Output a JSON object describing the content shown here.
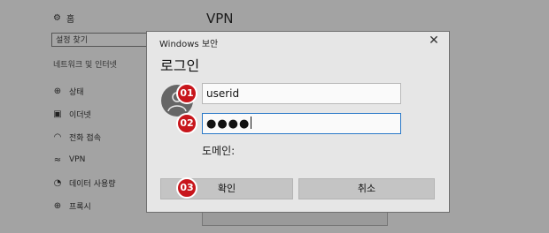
{
  "background": {
    "home": {
      "label": "홈",
      "icon": "gear-icon"
    },
    "search_placeholder": "설정 찾기",
    "section_label": "네트워크 및 인터넷",
    "nav": [
      {
        "label": "상태",
        "icon": "globe-icon"
      },
      {
        "label": "이더넷",
        "icon": "ethernet-icon"
      },
      {
        "label": "전화 접속",
        "icon": "wifi-icon"
      },
      {
        "label": "VPN",
        "icon": "vpn-icon"
      },
      {
        "label": "데이터 사용량",
        "icon": "clock-icon"
      },
      {
        "label": "프록시",
        "icon": "globe-icon"
      }
    ],
    "page_title": "VPN"
  },
  "dialog": {
    "title": "Windows 보안",
    "close_icon": "close-icon",
    "heading": "로그인",
    "username_value": "userid",
    "password_mask": "●●●●",
    "domain_label": "도메인:",
    "ok_label": "확인",
    "cancel_label": "취소"
  },
  "callouts": {
    "one": "01",
    "two": "02",
    "three": "03"
  },
  "colors": {
    "callout": "#c8161c",
    "focus_border": "#2a79c8"
  }
}
